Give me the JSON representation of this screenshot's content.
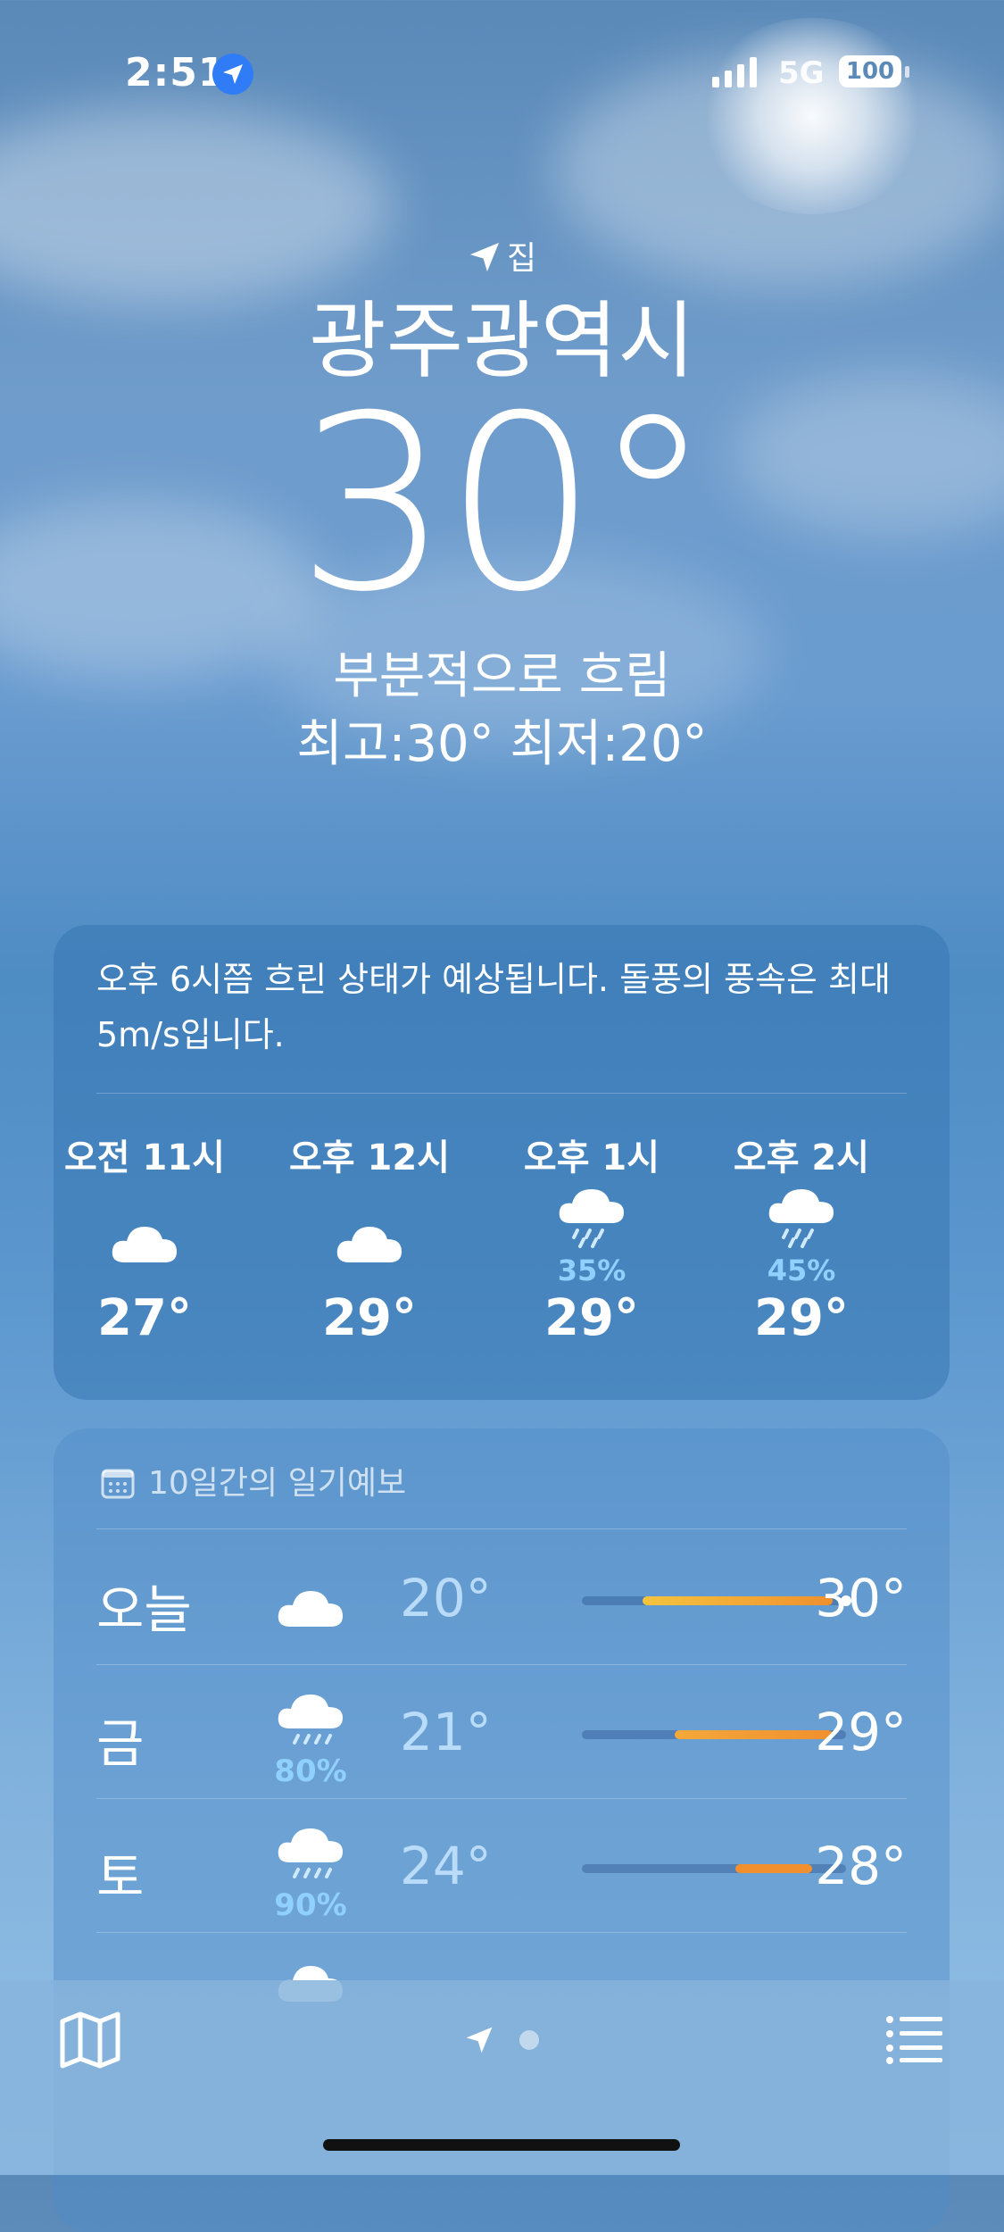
{
  "status": {
    "time": "2:51",
    "network": "5G",
    "battery": "100"
  },
  "header": {
    "location_label": "집",
    "city": "광주광역시",
    "temperature": "30°",
    "condition": "부분적으로 흐림",
    "hilo": "최고:30°  최저:20°"
  },
  "hourly": {
    "summary": "오후 6시쯤 흐린 상태가 예상됩니다. 돌풍의 풍속은 최대 5m/s입니다.",
    "hours": [
      {
        "label": "오전 11시",
        "icon": "cloud-icon",
        "precip": "",
        "temp": "27°"
      },
      {
        "label": "오후 12시",
        "icon": "cloud-icon",
        "precip": "",
        "temp": "29°"
      },
      {
        "label": "오후 1시",
        "icon": "cloud-rain-icon",
        "precip": "35%",
        "temp": "29°"
      },
      {
        "label": "오후 2시",
        "icon": "cloud-rain-icon",
        "precip": "45%",
        "temp": "29°"
      }
    ]
  },
  "forecast": {
    "title": "10일간의 일기예보",
    "days": [
      {
        "day": "오늘",
        "icon": "cloud-icon",
        "precip": "",
        "low": "20°",
        "high": "30°",
        "range_start": 0.23,
        "range_end": 0.95,
        "current": 1.0
      },
      {
        "day": "금",
        "icon": "cloud-rain-icon",
        "precip": "80%",
        "low": "21°",
        "high": "29°",
        "range_start": 0.35,
        "range_end": 0.95
      },
      {
        "day": "토",
        "icon": "cloud-rain-icon",
        "precip": "90%",
        "low": "24°",
        "high": "28°",
        "range_start": 0.58,
        "range_end": 0.87
      }
    ]
  },
  "colors": {
    "accent_orange": "#f0902e",
    "accent_yellow": "#f4c43f",
    "precip_blue": "#8fd0ff",
    "location_badge": "#2f7cf6"
  }
}
